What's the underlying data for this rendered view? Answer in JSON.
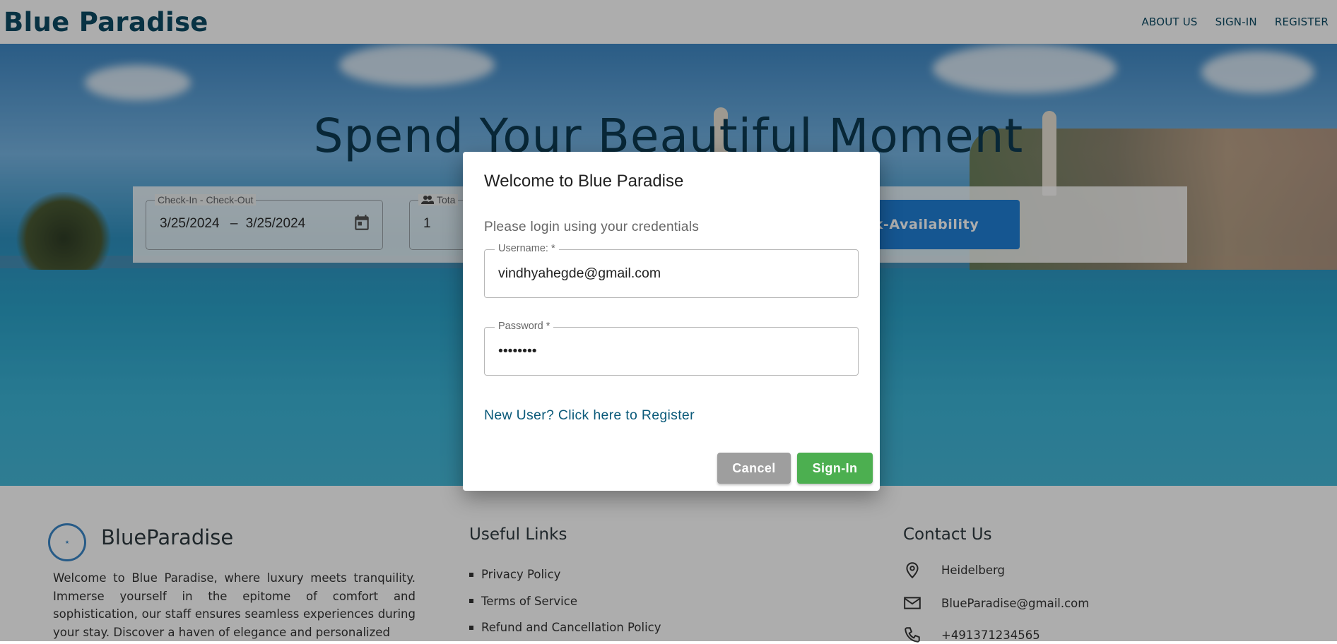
{
  "header": {
    "brand": "Blue Paradise",
    "nav": [
      "ABOUT US",
      "SIGN-IN",
      "REGISTER"
    ]
  },
  "hero": {
    "title": "Spend Your Beautiful Moment"
  },
  "search": {
    "dates_label": "Check-In - Check-Out",
    "check_in": "3/25/2024",
    "dash": "–",
    "check_out": "3/25/2024",
    "guests_label": "Tota",
    "guests_value": "1",
    "check_button": "Check-Availability"
  },
  "dialog": {
    "title": "Welcome to Blue Paradise",
    "subtitle": "Please login using your credentials",
    "username_label": "Username: *",
    "username_value": "vindhyahegde@gmail.com",
    "password_label": "Password *",
    "password_value": "password",
    "register_link": "New User? Click here to Register",
    "cancel": "Cancel",
    "sign_in": "Sign-In"
  },
  "footer": {
    "brand": "BlueParadise",
    "about": "Welcome to Blue Paradise, where luxury meets tranquility. Immerse yourself in the epitome of comfort and sophistication, our staff ensures seamless experiences during your stay. Discover a haven of elegance and personalized",
    "links_heading": "Useful Links",
    "links": [
      "Privacy Policy",
      "Terms of Service",
      "Refund and Cancellation Policy"
    ],
    "contact_heading": "Contact Us",
    "location": "Heidelberg",
    "email": "BlueParadise@gmail.com",
    "phone": "+491371234565"
  },
  "colors": {
    "brand": "#0d4a63",
    "primary_button": "#1f7fd6",
    "signin_button": "#4caf50",
    "cancel_button": "#9e9e9e",
    "link": "#0b5a7a"
  },
  "icons": [
    "calendar-icon",
    "people-icon",
    "location-pin-icon",
    "mail-icon",
    "phone-icon"
  ]
}
